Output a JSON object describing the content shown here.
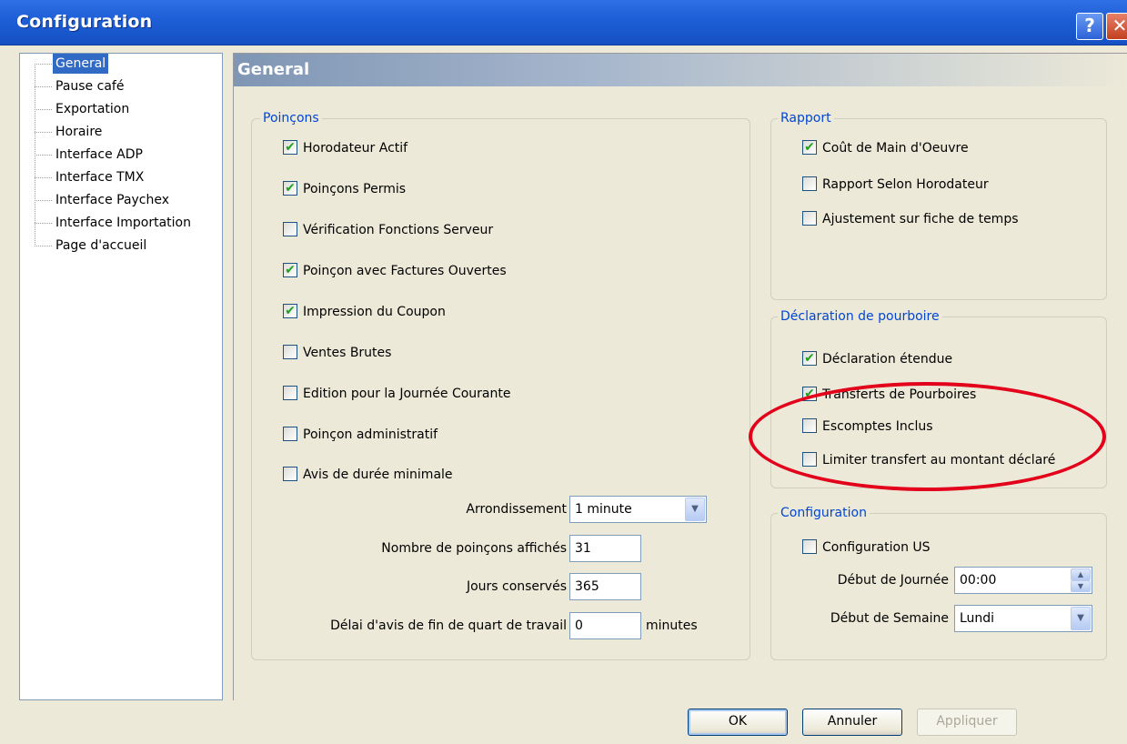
{
  "window": {
    "title": "Configuration",
    "help_label": "?",
    "close_label": "✕"
  },
  "tree": {
    "items": [
      "General",
      "Pause café",
      "Exportation",
      "Horaire",
      "Interface ADP",
      "Interface TMX",
      "Interface Paychex",
      "Interface Importation",
      "Page d'accueil"
    ],
    "selected": "General"
  },
  "panel": {
    "title": "General"
  },
  "poincons": {
    "legend": "Poinçons",
    "checkboxes": [
      {
        "label": "Horodateur Actif",
        "checked": true
      },
      {
        "label": "Poinçons Permis",
        "checked": true
      },
      {
        "label": "Vérification Fonctions Serveur",
        "checked": false
      },
      {
        "label": "Poinçon avec Factures Ouvertes",
        "checked": true
      },
      {
        "label": "Impression du Coupon",
        "checked": true
      },
      {
        "label": "Ventes Brutes",
        "checked": false
      },
      {
        "label": "Edition pour la Journée Courante",
        "checked": false
      },
      {
        "label": "Poinçon administratif",
        "checked": false
      },
      {
        "label": "Avis de durée minimale",
        "checked": false
      }
    ],
    "arrondissement": {
      "label": "Arrondissement",
      "value": "1 minute"
    },
    "nombre": {
      "label": "Nombre de poinçons affichés",
      "value": "31"
    },
    "jours": {
      "label": "Jours conservés",
      "value": "365"
    },
    "delai": {
      "label": "Délai d'avis de fin de quart de travail",
      "value": "0",
      "unit": "minutes"
    }
  },
  "rapport": {
    "legend": "Rapport",
    "checkboxes": [
      {
        "label": "Coût de Main d'Oeuvre",
        "checked": true
      },
      {
        "label": "Rapport Selon Horodateur",
        "checked": false
      },
      {
        "label": "Ajustement sur fiche de temps",
        "checked": false
      }
    ]
  },
  "pourboire": {
    "legend": "Déclaration de pourboire",
    "checkboxes": [
      {
        "label": "Déclaration étendue",
        "checked": true
      },
      {
        "label": "Transferts de Pourboires",
        "checked": true
      },
      {
        "label": "Escomptes Inclus",
        "checked": false
      },
      {
        "label": "Limiter transfert au montant déclaré",
        "checked": false
      }
    ]
  },
  "configuration": {
    "legend": "Configuration",
    "us": {
      "label": "Configuration US",
      "checked": false
    },
    "debut_journee": {
      "label": "Début de Journée",
      "value": "00:00"
    },
    "debut_semaine": {
      "label": "Début de Semaine",
      "value": "Lundi"
    }
  },
  "buttons": {
    "ok": "OK",
    "cancel": "Annuler",
    "apply": "Appliquer"
  },
  "icons": {
    "checkmark": "✔",
    "dropdown": "▼",
    "spin_up": "▲",
    "spin_down": "▼"
  },
  "colors": {
    "titlebar": "#1d5ed6",
    "selection": "#316ac5",
    "legend_text": "#0046d5",
    "checkmark": "#21a121",
    "annotation": "#e3001b"
  }
}
